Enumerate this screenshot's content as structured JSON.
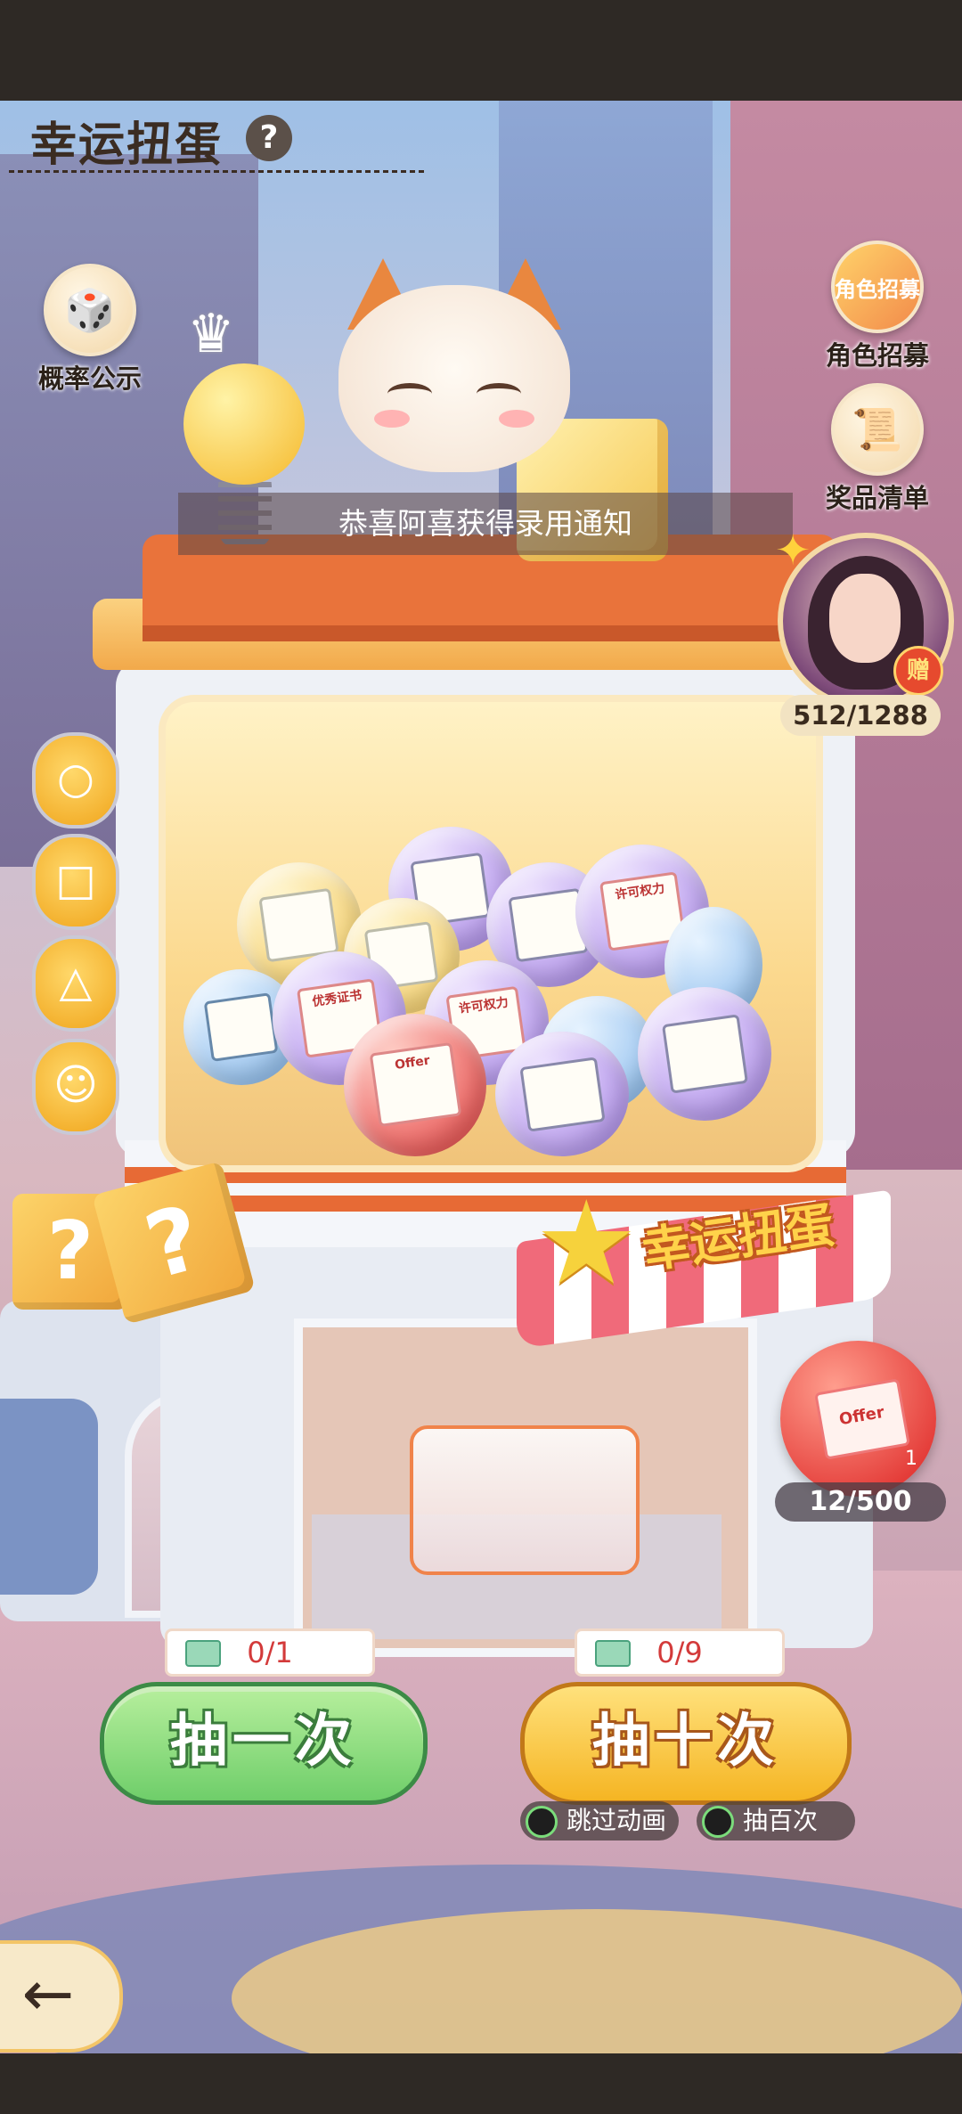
{
  "header": {
    "title": "幸运扭蛋",
    "help_symbol": "?"
  },
  "side_buttons": {
    "probability": {
      "label": "概率公示",
      "icon": "dice-icon"
    },
    "role_recruit": {
      "label": "角色招募",
      "icon": "recruit-card-icon",
      "badge_text": "角色招募"
    },
    "prize_list": {
      "label": "奖品清单",
      "icon": "scroll-list-icon"
    }
  },
  "notice": {
    "text": "恭喜阿喜获得录用通知"
  },
  "avatar": {
    "gift_tag": "赠",
    "progress": "512/1288"
  },
  "skill_coins": [
    "○",
    "□",
    "△",
    "☺"
  ],
  "machine": {
    "sign_text": "幸运扭蛋",
    "capsule_labels": [
      "许可权力",
      "优秀证书",
      "许可权力",
      "Offer"
    ]
  },
  "offer_item": {
    "card_text": "Offer",
    "count": "1",
    "progress": "12/500"
  },
  "draw_one": {
    "ticket_count": "0/1",
    "label": "抽一次"
  },
  "draw_ten": {
    "ticket_count": "0/9",
    "label": "抽十次"
  },
  "options": {
    "skip_animation": "跳过动画",
    "draw_hundred": "抽百次"
  },
  "back_button": {
    "symbol": "←"
  },
  "colors": {
    "accent_orange": "#e9733b",
    "button_green": "#6fce6a",
    "button_yellow": "#f5b523",
    "ticket_red": "#d33a3a"
  }
}
